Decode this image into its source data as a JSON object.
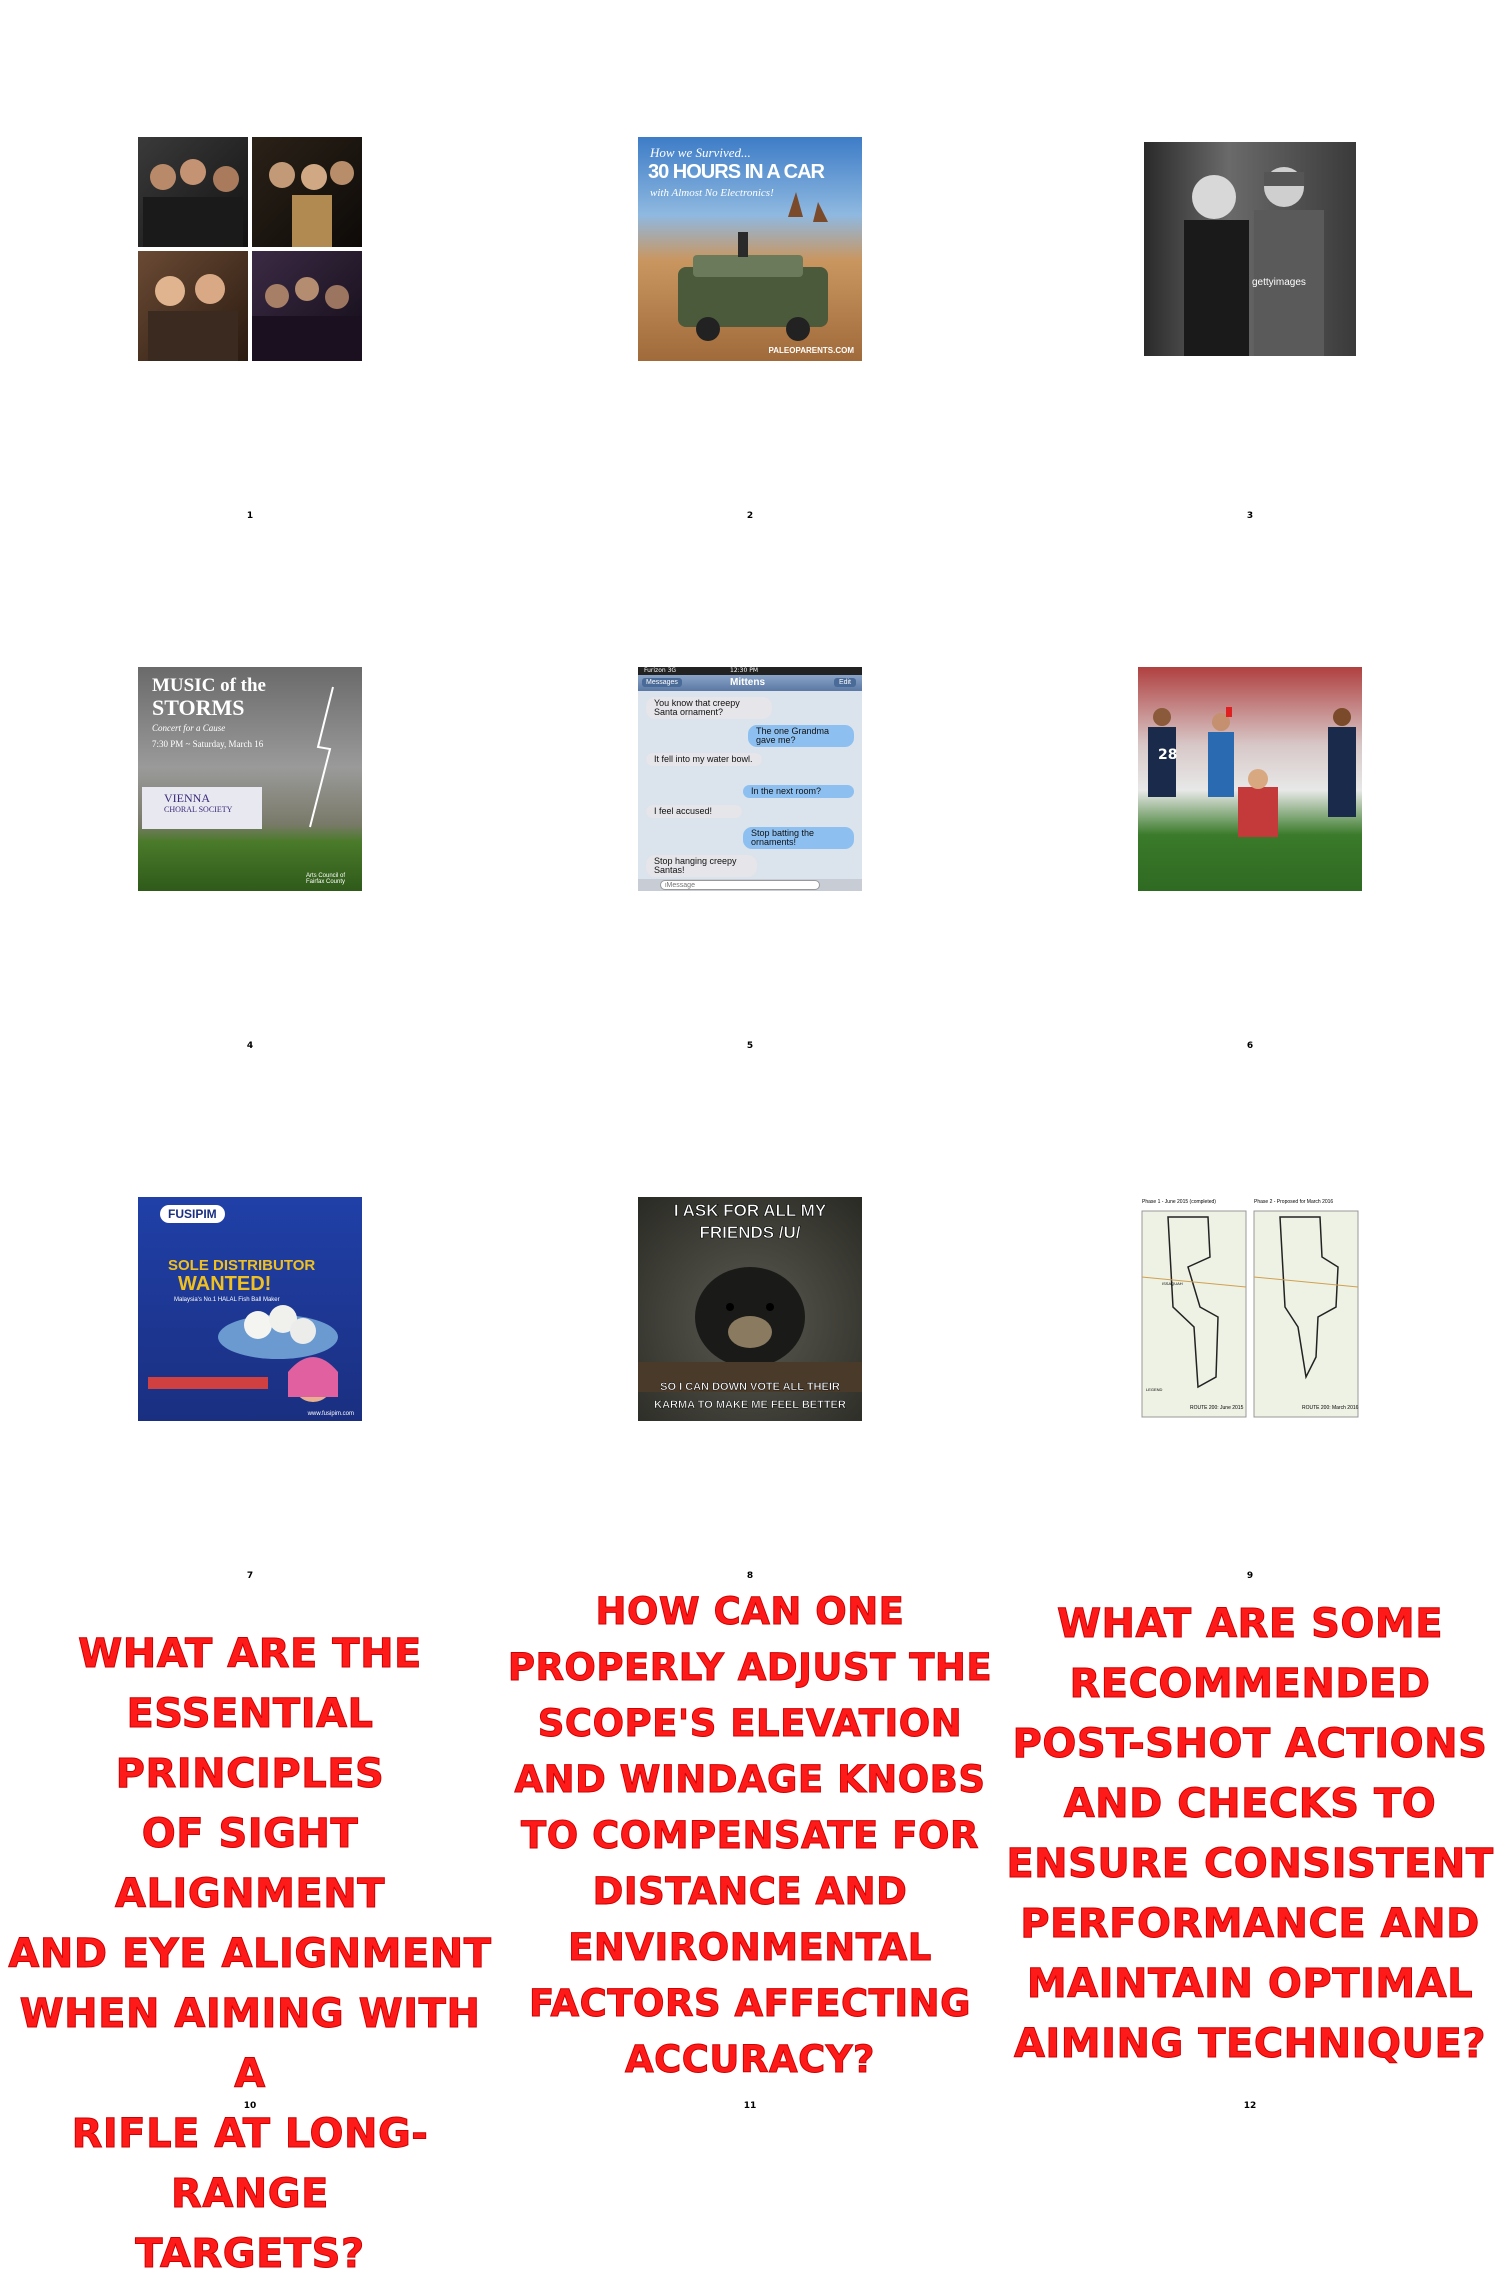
{
  "grid_labels": [
    "1",
    "2",
    "3",
    "4",
    "5",
    "6",
    "7",
    "8",
    "9",
    "10",
    "11",
    "12"
  ],
  "img2": {
    "line1": "How we Survived...",
    "line2": "30 HOURS IN A CAR",
    "line3": "with Almost No Electronics!",
    "credit": "PALEOPARENTS.COM"
  },
  "img3": {
    "watermark": "gettyimages"
  },
  "img4": {
    "title1": "MUSIC of the",
    "title2": "STORMS",
    "sub": "Concert for a Cause",
    "date": "7:30 PM ~ Saturday, March 16",
    "org1": "VIENNA",
    "org2": "CHORAL SOCIETY",
    "sponsor": "Arts Council of Fairfax County"
  },
  "img5": {
    "carrier": "Furizon 3G",
    "time": "12:30 PM",
    "back": "Messages",
    "contact": "Mittens",
    "edit": "Edit",
    "msgs": [
      "You know that creepy Santa ornament?",
      "The one Grandma gave me?",
      "It fell into my water bowl.",
      "In the next room?",
      "I feel accused!",
      "Stop batting the ornaments!",
      "Stop hanging creepy Santas!"
    ],
    "input": "iMessage"
  },
  "img6": {
    "shirt": "28"
  },
  "img7": {
    "brand": "FUSIPIM",
    "headline1": "SOLE DISTRIBUTOR",
    "headline2": "WANTED!",
    "tag": "Malaysia's No.1 HALAL Fish Ball Maker",
    "url": "www.fusipim.com"
  },
  "img8": {
    "top1": "I ASK FOR ALL MY",
    "top2": "FRIENDS /U/",
    "bottom1": "SO I CAN DOWN VOTE ALL THEIR",
    "bottom2": "KARMA TO MAKE ME FEEL BETTER"
  },
  "img9": {
    "left_title": "Phase 1 - June 2015 (completed)",
    "right_title": "Phase 2 - Proposed for March 2016",
    "left_route": "ROUTE 200: June 2015",
    "right_route": "ROUTE 200: March 2016",
    "town": "ISSAQUAH",
    "legend": "LEGEND"
  },
  "questions": [
    [
      "WHAT ARE THE",
      "ESSENTIAL PRINCIPLES",
      "OF SIGHT ALIGNMENT",
      "AND EYE ALIGNMENT",
      "WHEN AIMING WITH A",
      "RIFLE AT LONG-RANGE",
      "TARGETS?"
    ],
    [
      "HOW CAN ONE",
      "PROPERLY ADJUST THE",
      "SCOPE'S ELEVATION",
      "AND WINDAGE KNOBS",
      "TO COMPENSATE FOR",
      "DISTANCE AND",
      "ENVIRONMENTAL",
      "FACTORS AFFECTING",
      "ACCURACY?"
    ],
    [
      "WHAT ARE SOME",
      "RECOMMENDED",
      "POST-SHOT ACTIONS",
      "AND CHECKS TO",
      "ENSURE CONSISTENT",
      "PERFORMANCE AND",
      "MAINTAIN OPTIMAL",
      "AIMING TECHNIQUE?"
    ]
  ],
  "colors": {
    "question_text": "#ff1a1a"
  }
}
